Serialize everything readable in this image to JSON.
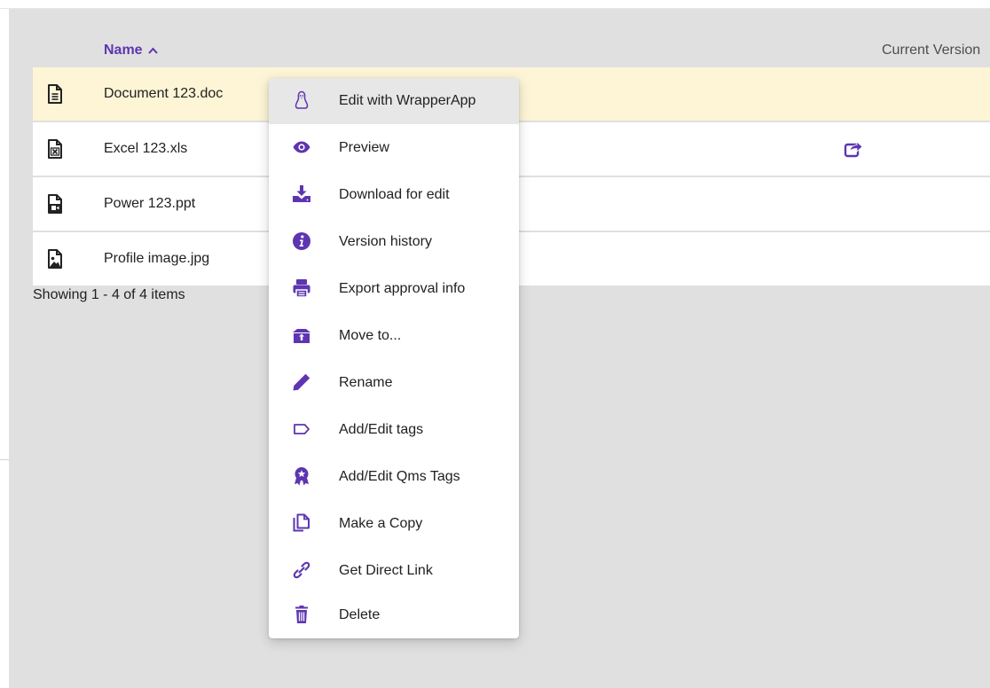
{
  "table": {
    "header": {
      "name_label": "Name",
      "sort_indicator": "^",
      "version_label": "Current Version"
    },
    "rows": [
      {
        "name": "Document 123.doc",
        "icon": "doc-file-icon",
        "selected": true
      },
      {
        "name": "Excel 123.xls",
        "icon": "xls-file-icon",
        "share_icon": "share-icon"
      },
      {
        "name": "Power 123.ppt",
        "icon": "ppt-file-icon"
      },
      {
        "name": "Profile image.jpg",
        "icon": "image-file-icon"
      }
    ],
    "footer": "Showing 1 - 4 of 4 items"
  },
  "context_menu": {
    "items": [
      {
        "label": "Edit with WrapperApp",
        "icon": "linux-penguin-icon"
      },
      {
        "label": "Preview",
        "icon": "eye-icon"
      },
      {
        "label": "Download for edit",
        "icon": "download-icon"
      },
      {
        "label": "Version history",
        "icon": "info-icon"
      },
      {
        "label": "Export approval info",
        "icon": "printer-icon"
      },
      {
        "label": "Move to...",
        "icon": "box-move-icon"
      },
      {
        "label": "Rename",
        "icon": "pencil-icon"
      },
      {
        "label": "Add/Edit tags",
        "icon": "tag-icon"
      },
      {
        "label": "Add/Edit Qms Tags",
        "icon": "award-icon"
      },
      {
        "label": "Make a Copy",
        "icon": "copy-icon"
      },
      {
        "label": "Get Direct Link",
        "icon": "link-icon"
      },
      {
        "label": "Delete",
        "icon": "trash-icon"
      }
    ]
  },
  "colors": {
    "accent": "#5e35b1",
    "selected_row": "#fdf5d6",
    "background": "#e0e0e0"
  }
}
